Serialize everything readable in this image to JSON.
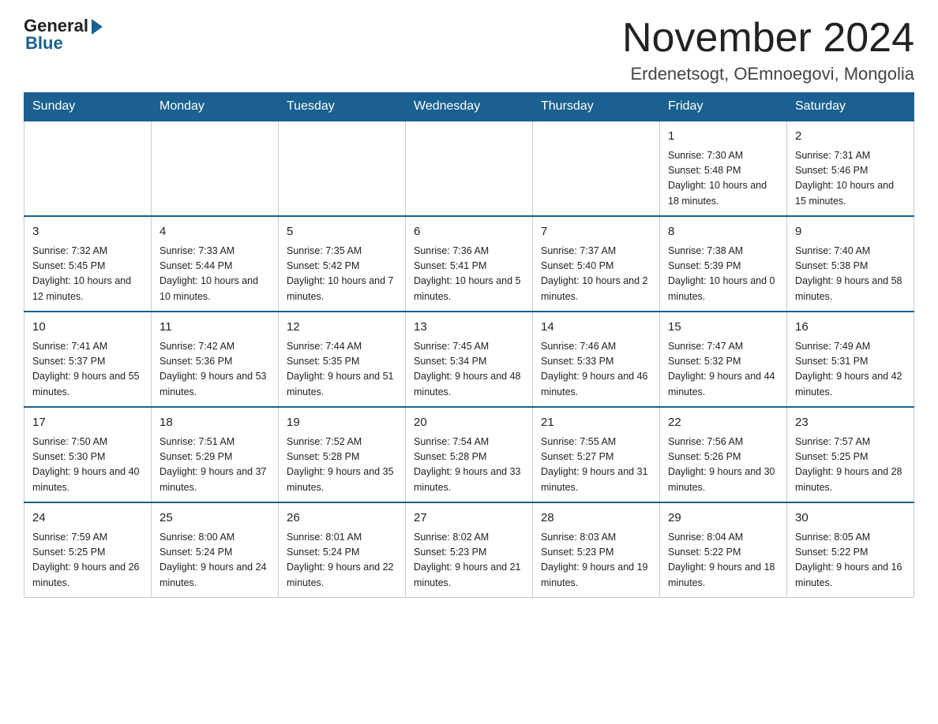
{
  "logo": {
    "general": "General",
    "blue": "Blue"
  },
  "header": {
    "month_year": "November 2024",
    "location": "Erdenetsogt, OEmnoegovi, Mongolia"
  },
  "days_of_week": [
    "Sunday",
    "Monday",
    "Tuesday",
    "Wednesday",
    "Thursday",
    "Friday",
    "Saturday"
  ],
  "weeks": [
    [
      {
        "day": "",
        "info": ""
      },
      {
        "day": "",
        "info": ""
      },
      {
        "day": "",
        "info": ""
      },
      {
        "day": "",
        "info": ""
      },
      {
        "day": "",
        "info": ""
      },
      {
        "day": "1",
        "info": "Sunrise: 7:30 AM\nSunset: 5:48 PM\nDaylight: 10 hours and 18 minutes."
      },
      {
        "day": "2",
        "info": "Sunrise: 7:31 AM\nSunset: 5:46 PM\nDaylight: 10 hours and 15 minutes."
      }
    ],
    [
      {
        "day": "3",
        "info": "Sunrise: 7:32 AM\nSunset: 5:45 PM\nDaylight: 10 hours and 12 minutes."
      },
      {
        "day": "4",
        "info": "Sunrise: 7:33 AM\nSunset: 5:44 PM\nDaylight: 10 hours and 10 minutes."
      },
      {
        "day": "5",
        "info": "Sunrise: 7:35 AM\nSunset: 5:42 PM\nDaylight: 10 hours and 7 minutes."
      },
      {
        "day": "6",
        "info": "Sunrise: 7:36 AM\nSunset: 5:41 PM\nDaylight: 10 hours and 5 minutes."
      },
      {
        "day": "7",
        "info": "Sunrise: 7:37 AM\nSunset: 5:40 PM\nDaylight: 10 hours and 2 minutes."
      },
      {
        "day": "8",
        "info": "Sunrise: 7:38 AM\nSunset: 5:39 PM\nDaylight: 10 hours and 0 minutes."
      },
      {
        "day": "9",
        "info": "Sunrise: 7:40 AM\nSunset: 5:38 PM\nDaylight: 9 hours and 58 minutes."
      }
    ],
    [
      {
        "day": "10",
        "info": "Sunrise: 7:41 AM\nSunset: 5:37 PM\nDaylight: 9 hours and 55 minutes."
      },
      {
        "day": "11",
        "info": "Sunrise: 7:42 AM\nSunset: 5:36 PM\nDaylight: 9 hours and 53 minutes."
      },
      {
        "day": "12",
        "info": "Sunrise: 7:44 AM\nSunset: 5:35 PM\nDaylight: 9 hours and 51 minutes."
      },
      {
        "day": "13",
        "info": "Sunrise: 7:45 AM\nSunset: 5:34 PM\nDaylight: 9 hours and 48 minutes."
      },
      {
        "day": "14",
        "info": "Sunrise: 7:46 AM\nSunset: 5:33 PM\nDaylight: 9 hours and 46 minutes."
      },
      {
        "day": "15",
        "info": "Sunrise: 7:47 AM\nSunset: 5:32 PM\nDaylight: 9 hours and 44 minutes."
      },
      {
        "day": "16",
        "info": "Sunrise: 7:49 AM\nSunset: 5:31 PM\nDaylight: 9 hours and 42 minutes."
      }
    ],
    [
      {
        "day": "17",
        "info": "Sunrise: 7:50 AM\nSunset: 5:30 PM\nDaylight: 9 hours and 40 minutes."
      },
      {
        "day": "18",
        "info": "Sunrise: 7:51 AM\nSunset: 5:29 PM\nDaylight: 9 hours and 37 minutes."
      },
      {
        "day": "19",
        "info": "Sunrise: 7:52 AM\nSunset: 5:28 PM\nDaylight: 9 hours and 35 minutes."
      },
      {
        "day": "20",
        "info": "Sunrise: 7:54 AM\nSunset: 5:28 PM\nDaylight: 9 hours and 33 minutes."
      },
      {
        "day": "21",
        "info": "Sunrise: 7:55 AM\nSunset: 5:27 PM\nDaylight: 9 hours and 31 minutes."
      },
      {
        "day": "22",
        "info": "Sunrise: 7:56 AM\nSunset: 5:26 PM\nDaylight: 9 hours and 30 minutes."
      },
      {
        "day": "23",
        "info": "Sunrise: 7:57 AM\nSunset: 5:25 PM\nDaylight: 9 hours and 28 minutes."
      }
    ],
    [
      {
        "day": "24",
        "info": "Sunrise: 7:59 AM\nSunset: 5:25 PM\nDaylight: 9 hours and 26 minutes."
      },
      {
        "day": "25",
        "info": "Sunrise: 8:00 AM\nSunset: 5:24 PM\nDaylight: 9 hours and 24 minutes."
      },
      {
        "day": "26",
        "info": "Sunrise: 8:01 AM\nSunset: 5:24 PM\nDaylight: 9 hours and 22 minutes."
      },
      {
        "day": "27",
        "info": "Sunrise: 8:02 AM\nSunset: 5:23 PM\nDaylight: 9 hours and 21 minutes."
      },
      {
        "day": "28",
        "info": "Sunrise: 8:03 AM\nSunset: 5:23 PM\nDaylight: 9 hours and 19 minutes."
      },
      {
        "day": "29",
        "info": "Sunrise: 8:04 AM\nSunset: 5:22 PM\nDaylight: 9 hours and 18 minutes."
      },
      {
        "day": "30",
        "info": "Sunrise: 8:05 AM\nSunset: 5:22 PM\nDaylight: 9 hours and 16 minutes."
      }
    ]
  ]
}
